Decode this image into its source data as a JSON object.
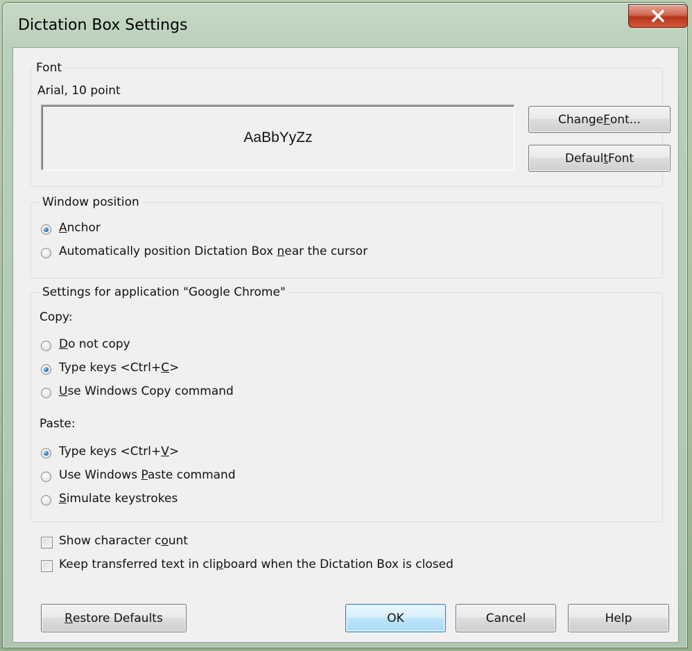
{
  "window": {
    "title": "Dictation Box Settings",
    "close_glyph": "X"
  },
  "font_group": {
    "legend": "Font",
    "description": "Arial, 10 point",
    "sample": "AaBbYyZz",
    "change_font": {
      "pre": "Change ",
      "u": "F",
      "post": "ont..."
    },
    "default_font": {
      "pre": "Defaul",
      "u": "t",
      "post": " Font"
    }
  },
  "position_group": {
    "legend": "Window position",
    "options": [
      {
        "pre": "",
        "u": "A",
        "post": "nchor",
        "selected": true
      },
      {
        "pre": "Automatically position Dictation Box ",
        "u": "n",
        "post": "ear the cursor",
        "selected": false
      }
    ]
  },
  "app_group": {
    "legend": "Settings for application \"Google Chrome\"",
    "copy_label": "Copy:",
    "copy_options": [
      {
        "pre": "",
        "u": "D",
        "post": "o not copy",
        "selected": false
      },
      {
        "pre": "Type keys <Ctrl+",
        "u": "C",
        "post": ">",
        "selected": true
      },
      {
        "pre": "",
        "u": "U",
        "post": "se Windows Copy command",
        "selected": false
      }
    ],
    "paste_label": "Paste:",
    "paste_options": [
      {
        "pre": "Type keys <Ctrl+",
        "u": "V",
        "post": ">",
        "selected": true
      },
      {
        "pre": "Use Windows ",
        "u": "P",
        "post": "aste command",
        "selected": false
      },
      {
        "pre": "",
        "u": "S",
        "post": "imulate keystrokes",
        "selected": false
      }
    ]
  },
  "checkboxes": [
    {
      "pre": "Show character c",
      "u": "o",
      "post": "unt",
      "checked": false
    },
    {
      "pre": "Keep transferred text in cli",
      "u": "p",
      "post": "board when the Dictation Box is closed",
      "checked": false
    }
  ],
  "buttons": {
    "restore": {
      "pre": "",
      "u": "R",
      "post": "estore Defaults"
    },
    "ok": "OK",
    "cancel": "Cancel",
    "help": "Help"
  },
  "colors": {
    "accent": "#2b7fc4",
    "close": "#c7432a",
    "background": "#f0f0f0"
  }
}
